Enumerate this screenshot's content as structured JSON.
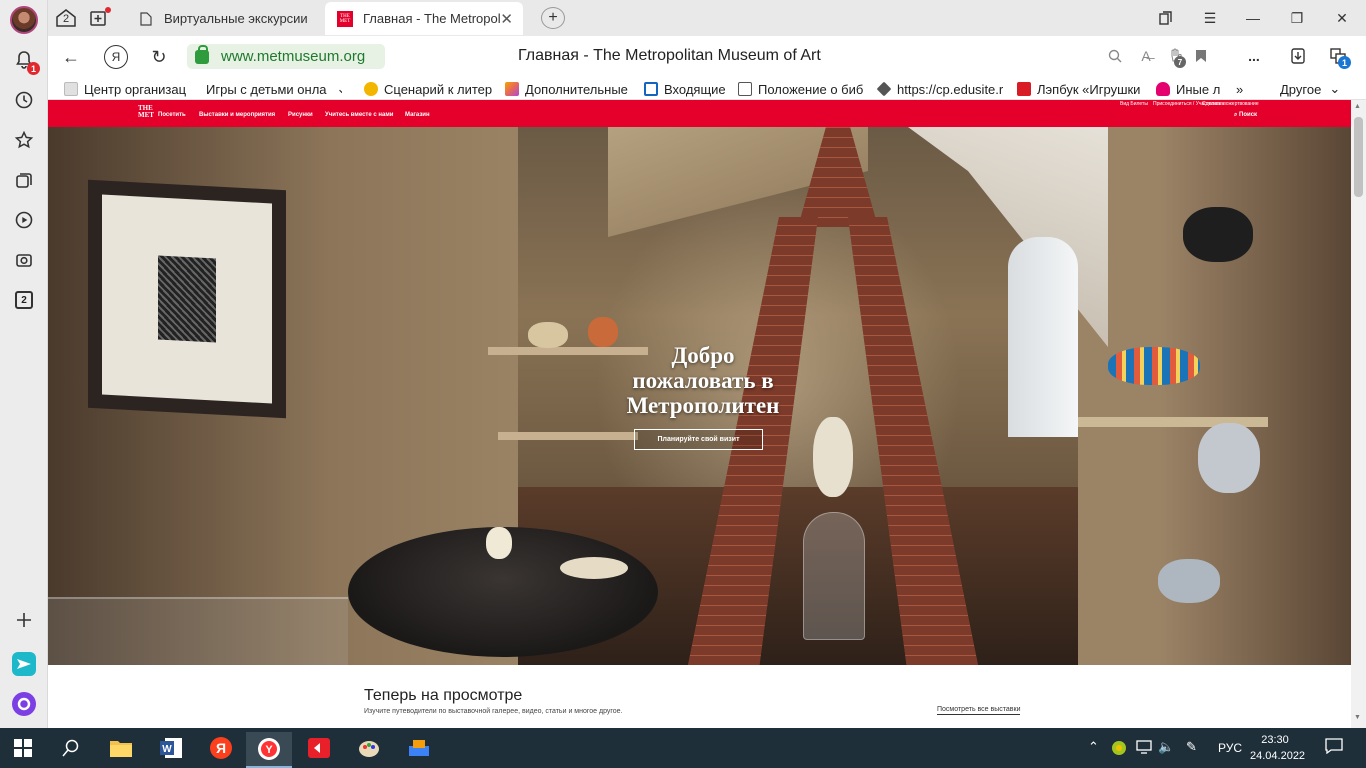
{
  "sidebar": {
    "notifications_badge": "1",
    "tabs_count": "2"
  },
  "tabs": {
    "count": "2",
    "items": [
      {
        "label": "Виртуальные экскурсии"
      },
      {
        "label": "Главная - The Metropol"
      }
    ]
  },
  "addressbar": {
    "url": "www.metmuseum.org",
    "page_title": "Главная - The Metropolitan Museum of Art",
    "downloads_badge": "7",
    "menu_dots": "...",
    "extensions_badge": "1"
  },
  "bookmarks": {
    "items": [
      {
        "label": "Центр организац",
        "color": "#e0e0e0"
      },
      {
        "label": "Игры с детьми онла",
        "color": "#ffffff"
      },
      {
        "label": "Сценарий к литер",
        "color": "#f2b600"
      },
      {
        "label": "Дополнительные",
        "color": "#e6685a"
      },
      {
        "label": "Входящие",
        "color": "#1565c0"
      },
      {
        "label": "Положение о биб",
        "color": "#ffffff"
      },
      {
        "label": "https://cp.edusite.r",
        "color": "#555555"
      },
      {
        "label": "Лэпбук «Игрушки",
        "color": "#d81b24"
      },
      {
        "label": "Иные л",
        "color": "#e4006e"
      }
    ],
    "more": "»",
    "other": "Другое"
  },
  "met": {
    "logo_line1": "THE",
    "logo_line2": "MET",
    "nav": [
      "Посетить",
      "Выставки и мероприятия",
      "Рисунки",
      "Учитесь вместе с нами",
      "Магазин"
    ],
    "util": [
      "Вид Билеты",
      "Присоединиться / Участвовать",
      "Сделать пожертвование"
    ],
    "search": "Поиск",
    "hero_title": "Добро пожаловать в Метрополитен",
    "hero_button": "Планируйте свой визит",
    "section_title": "Теперь на просмотре",
    "section_subtitle": "Изучите путеводители по выставочной галерее, видео, статьи и многое другое.",
    "section_link": "Посмотреть все выставки"
  },
  "taskbar": {
    "language": "РУС",
    "time": "23:30",
    "date": "24.04.2022"
  }
}
